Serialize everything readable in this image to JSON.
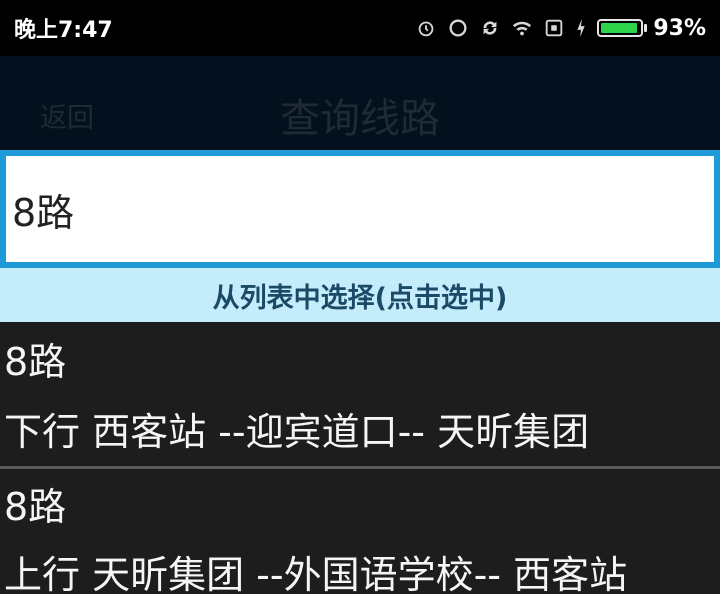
{
  "status_bar": {
    "time": "晚上7:47",
    "battery_percent_text": "93%",
    "battery_level": 0.93,
    "icons": [
      "alarm-icon",
      "circle-icon",
      "sync-icon",
      "wifi-icon",
      "sim-icon",
      "charging-icon",
      "battery-icon"
    ]
  },
  "header": {
    "back_label": "返回",
    "title": "查询线路"
  },
  "search": {
    "value": "8路"
  },
  "hint": {
    "text": "从列表中选择(点击选中)"
  },
  "results": [
    {
      "name": "8路",
      "route": "下行 西客站 --迎宾道口-- 天昕集团"
    },
    {
      "name": "8路",
      "route": "上行 天昕集团 --外国语学校-- 西客站"
    }
  ],
  "colors": {
    "accent_border": "#1e9bd6",
    "hint_background": "#c5ecfb",
    "battery_green": "#2fd34a"
  }
}
